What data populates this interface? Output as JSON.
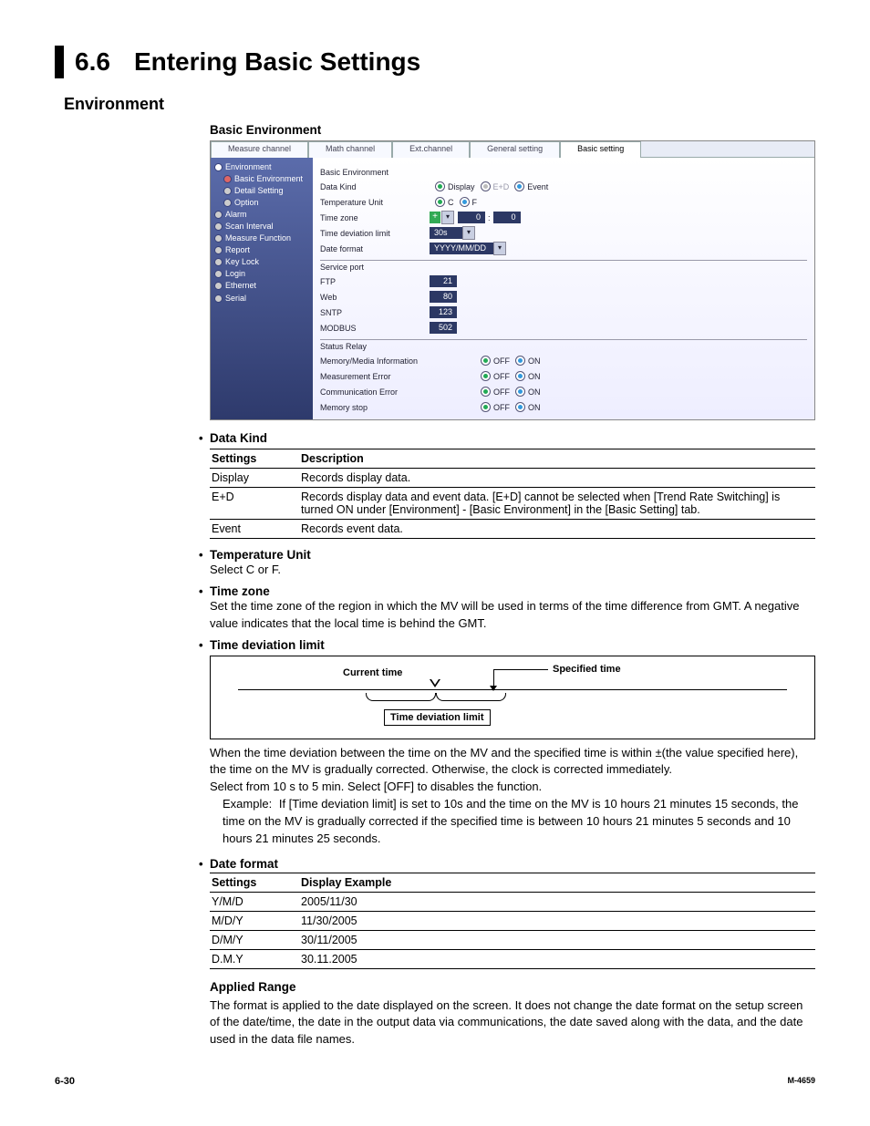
{
  "chapter": {
    "num": "6.6",
    "title": "Entering Basic Settings"
  },
  "h2_environment": "Environment",
  "h3_basicenv": "Basic Environment",
  "tabs": [
    "Measure channel",
    "Math channel",
    "Ext.channel",
    "General setting",
    "Basic setting"
  ],
  "tree": {
    "env": "Environment",
    "basicenv": "Basic Environment",
    "detail": "Detail Setting",
    "option": "Option",
    "alarm": "Alarm",
    "scan": "Scan Interval",
    "meas": "Measure Function",
    "report": "Report",
    "keylock": "Key Lock",
    "login": "Login",
    "ethernet": "Ethernet",
    "serial": "Serial"
  },
  "form": {
    "group_basicenv": "Basic Environment",
    "datakind": "Data Kind",
    "datakind_opts": {
      "display": "Display",
      "ed": "E+D",
      "event": "Event"
    },
    "tempunit": "Temperature Unit",
    "tempunit_opts": {
      "c": "C",
      "f": "F"
    },
    "timezone": "Time zone",
    "timezone_val_h": "0",
    "timezone_val_m": "0",
    "tdl": "Time deviation limit",
    "tdl_val": "30s",
    "dateformat": "Date format",
    "dateformat_val": "YYYY/MM/DD",
    "group_serviceport": "Service port",
    "ftp": "FTP",
    "ftp_v": "21",
    "web": "Web",
    "web_v": "80",
    "sntp": "SNTP",
    "sntp_v": "123",
    "modbus": "MODBUS",
    "modbus_v": "502",
    "group_statusrelay": "Status Relay",
    "mmi": "Memory/Media Information",
    "merr": "Measurement Error",
    "cerr": "Communication Error",
    "mstop": "Memory stop",
    "off": "OFF",
    "on": "ON"
  },
  "datakind": {
    "title": "Data Kind",
    "hdr_settings": "Settings",
    "hdr_desc": "Description",
    "rows": [
      {
        "s": "Display",
        "d": "Records display data."
      },
      {
        "s": "E+D",
        "d": "Records display data and event data.   [E+D] cannot be selected when [Trend Rate Switching] is turned ON under [Environment] - [Basic Environment] in the [Basic Setting] tab."
      },
      {
        "s": "Event",
        "d": "Records event data."
      }
    ]
  },
  "tempunit": {
    "title": "Temperature Unit",
    "body": "Select C or F."
  },
  "timezone": {
    "title": "Time zone",
    "body": "Set the time zone of the region in which the MV will be used in terms of the time difference from GMT.  A negative value indicates that the local time is behind the GMT."
  },
  "tdl": {
    "title": "Time deviation limit",
    "diag": {
      "current": "Current time",
      "specified": "Specified time",
      "limit": "Time deviation limit"
    },
    "body1": "When the time deviation between the time on the MV and the specified time is within ±(the value specified here), the time on the MV is gradually corrected.  Otherwise, the clock is corrected immediately.",
    "body2": "Select from 10 s to 5 min.  Select [OFF] to disables the function.",
    "ex_lead": "Example:",
    "ex1": "If [Time deviation limit] is set to 10s and the time on the MV is 10 hours 21 minutes 15 seconds, the time on the MV is gradually corrected if the specified time is between 10 hours 21 minutes 5 seconds and 10 hours 21 minutes 25 seconds."
  },
  "dateformat": {
    "title": "Date format",
    "hdr_settings": "Settings",
    "hdr_ex": "Display Example",
    "rows": [
      {
        "s": "Y/M/D",
        "d": "2005/11/30"
      },
      {
        "s": "M/D/Y",
        "d": "11/30/2005"
      },
      {
        "s": "D/M/Y",
        "d": "30/11/2005"
      },
      {
        "s": "D.M.Y",
        "d": "30.11.2005"
      }
    ]
  },
  "appliedrange": {
    "title": "Applied Range",
    "body": "The format is applied to the date displayed on the screen.  It does not change the date format on the setup screen of the date/time, the date in the output data via communications, the date saved along with the data, and the date used in the data file names."
  },
  "footer": {
    "page": "6-30",
    "doc": "M-4659"
  }
}
